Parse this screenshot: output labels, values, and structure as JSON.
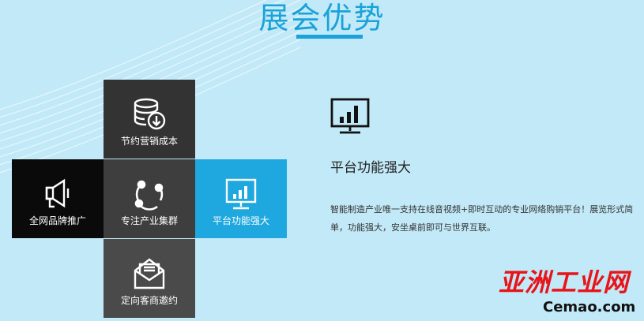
{
  "section": {
    "title": "展会优势"
  },
  "tiles": {
    "save": {
      "label": "节约营销成本",
      "icon": "database-download-icon"
    },
    "all": {
      "label": "全网品牌推广",
      "icon": "megaphone-icon"
    },
    "focus": {
      "label": "专注产业集群",
      "icon": "cycle-nodes-icon"
    },
    "platform": {
      "label": "平台功能强大",
      "icon": "monitor-chart-icon"
    },
    "invite": {
      "label": "定向客商邀约",
      "icon": "envelope-letter-icon"
    }
  },
  "feature": {
    "icon": "monitor-chart-icon",
    "title": "平台功能强大",
    "description": "智能制造产业唯一支持在线音视频+即时互动的专业网络购销平台！展览形式简单，功能强大，安坐桌前即可与世界互联。"
  },
  "watermark": {
    "brand": "亚洲工业网",
    "url": "Cemao.com"
  },
  "colors": {
    "accent": "#1aa2d9",
    "background": "#c2e9f7",
    "watermark_red": "#e8141a"
  }
}
